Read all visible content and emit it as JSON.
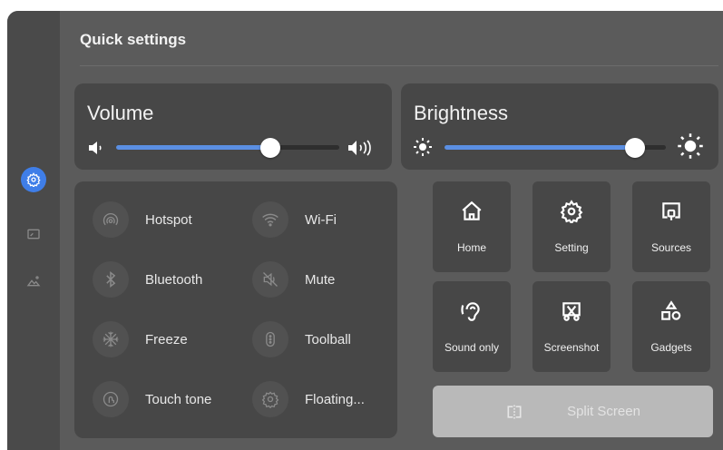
{
  "panel": {
    "title": "Quick settings"
  },
  "sidebar": {
    "items": [
      {
        "icon": "settings-gear-icon",
        "active": true
      },
      {
        "icon": "display-icon",
        "active": false
      },
      {
        "icon": "picture-icon",
        "active": false
      }
    ]
  },
  "volume": {
    "label": "Volume",
    "level_percent": 69
  },
  "brightness": {
    "label": "Brightness",
    "level_percent": 86
  },
  "toggles": [
    {
      "label": "Hotspot",
      "icon": "hotspot-icon"
    },
    {
      "label": "Wi-Fi",
      "icon": "wifi-icon"
    },
    {
      "label": "Bluetooth",
      "icon": "bluetooth-icon"
    },
    {
      "label": "Mute",
      "icon": "mute-icon"
    },
    {
      "label": "Freeze",
      "icon": "snowflake-icon"
    },
    {
      "label": "Toolball",
      "icon": "toolball-icon"
    },
    {
      "label": "Touch tone",
      "icon": "touch-tone-icon"
    },
    {
      "label": "Floating...",
      "icon": "floating-gear-icon"
    }
  ],
  "tiles": [
    {
      "label": "Home",
      "icon": "home-icon"
    },
    {
      "label": "Setting",
      "icon": "gear-icon"
    },
    {
      "label": "Sources",
      "icon": "sources-icon"
    },
    {
      "label": "Sound only",
      "icon": "ear-icon"
    },
    {
      "label": "Screenshot",
      "icon": "screenshot-icon"
    },
    {
      "label": "Gadgets",
      "icon": "gadgets-icon"
    }
  ],
  "split_screen": {
    "label": "Split Screen",
    "icon": "split-screen-icon",
    "enabled": false
  },
  "colors": {
    "accent": "#3f7ee8",
    "slider_fill": "#5b8fe3",
    "panel_bg": "#5b5b5b",
    "card_bg": "#474747"
  }
}
